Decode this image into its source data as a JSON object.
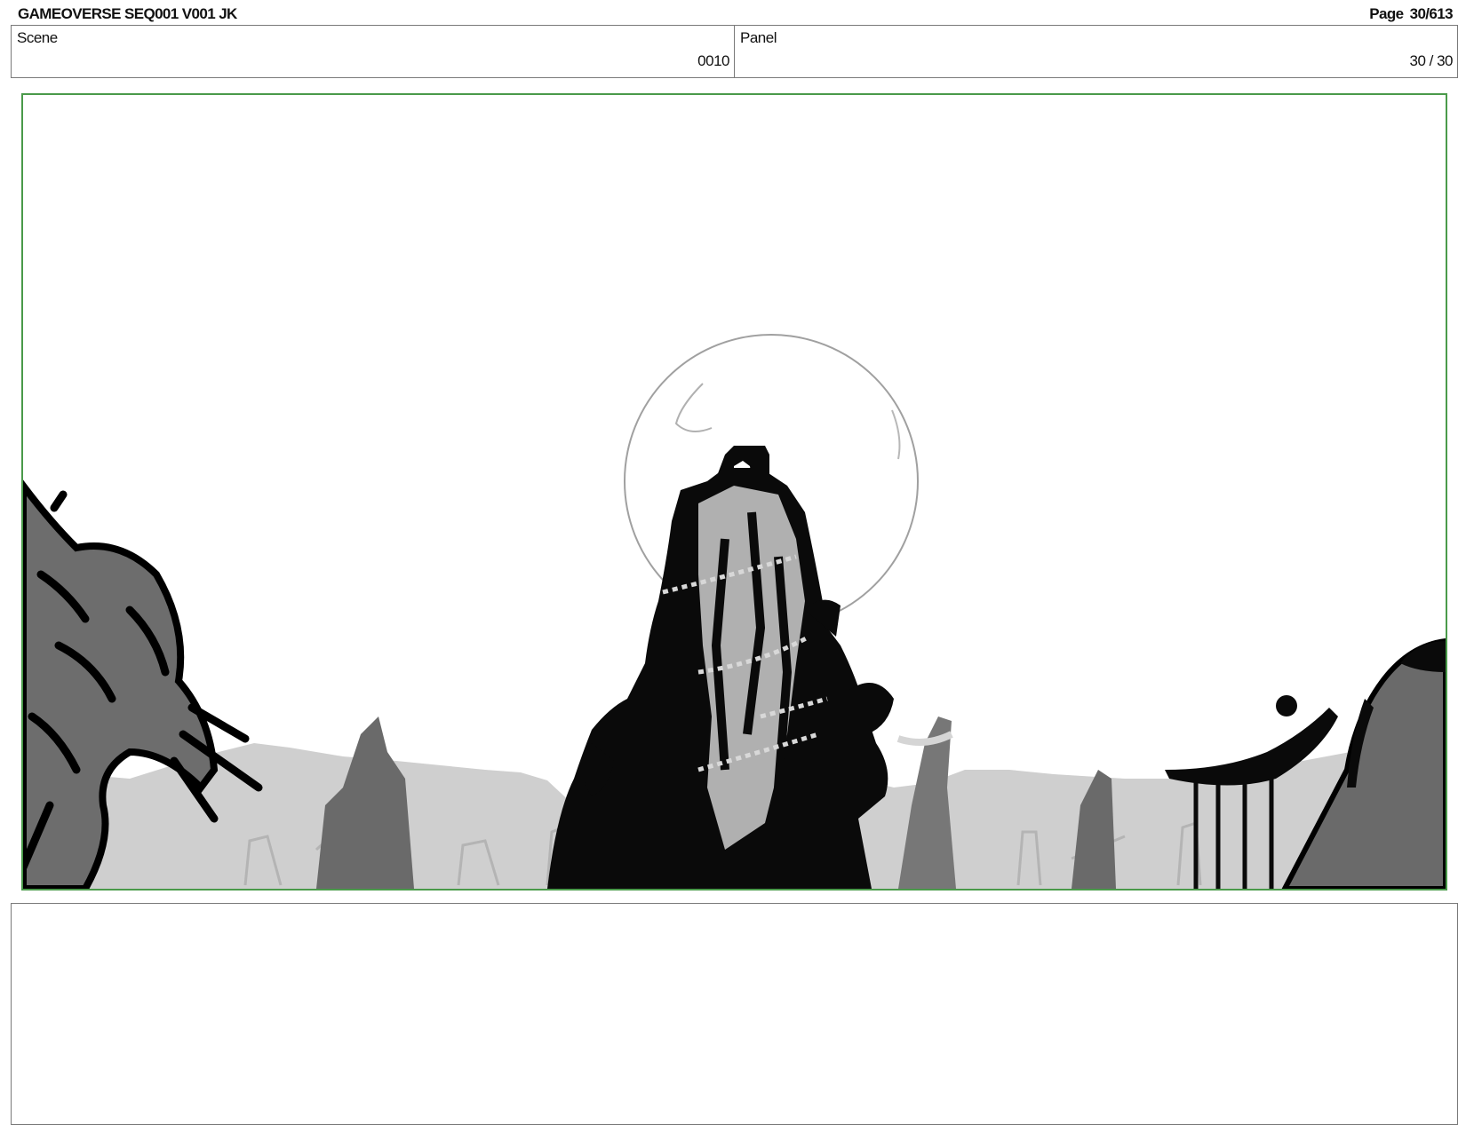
{
  "header": {
    "title": "GAMEOVERSE SEQ001 V001 JK",
    "page": "Page  30/613"
  },
  "info": {
    "scene_label": "Scene",
    "scene_value": "0010",
    "panel_label": "Panel",
    "panel_value": "30 / 30"
  },
  "frame": {
    "border_color": "#4a9a4a"
  },
  "notes": {
    "text": ""
  }
}
